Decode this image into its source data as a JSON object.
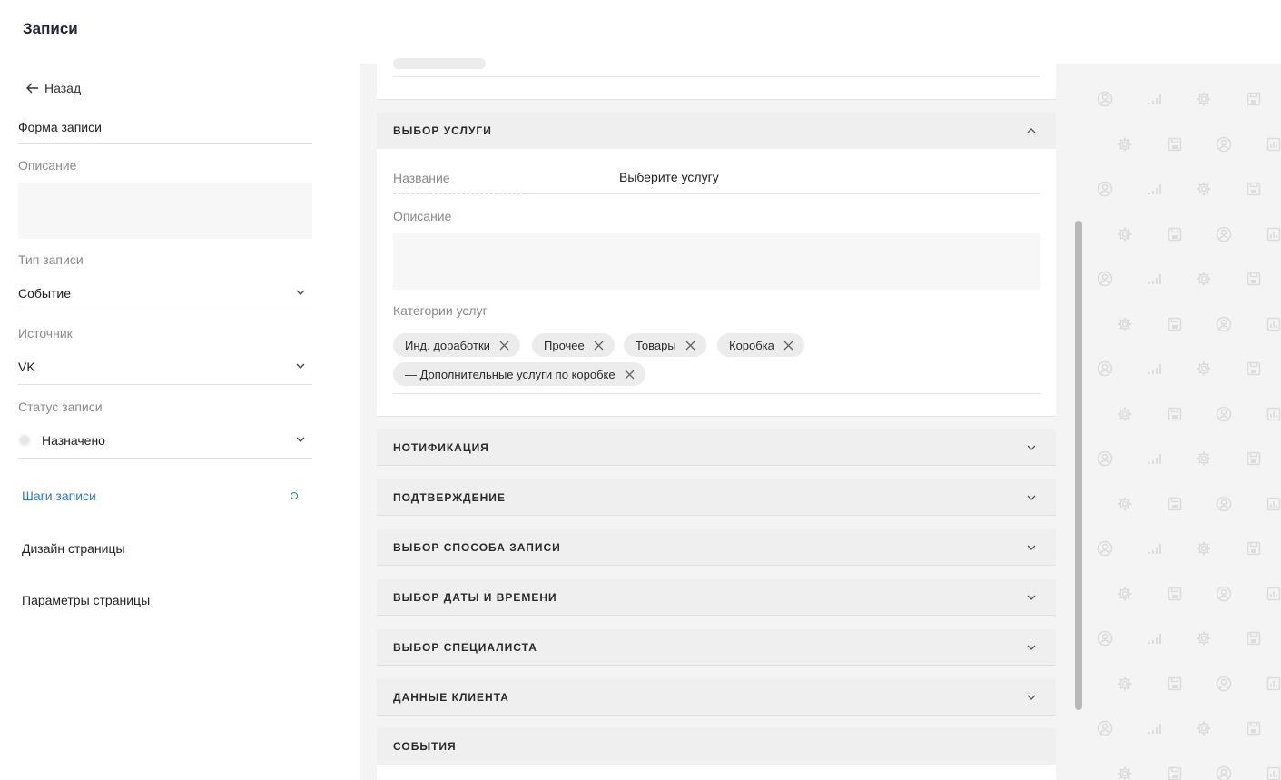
{
  "app": {
    "title": "Записи"
  },
  "left": {
    "back_label": "Назад",
    "form_value": "Форма записи",
    "description_label": "Описание",
    "type_label": "Тип записи",
    "type_value": "Событие",
    "source_label": "Источник",
    "source_value": "VK",
    "status_label": "Статус записи",
    "status_value": "Назначено",
    "nav": [
      {
        "label": "Шаги записи"
      },
      {
        "label": "Дизайн страницы"
      },
      {
        "label": "Параметры страницы"
      }
    ]
  },
  "service": {
    "header": "ВЫБОР УСЛУГИ",
    "name_label": "Название",
    "name_value": "Выберите услугу",
    "description_label": "Описание",
    "categories_label": "Категории услуг",
    "chips": [
      "Инд. доработки",
      "Прочее",
      "Товары",
      "Коробка",
      "— Дополнительные услуги по коробке"
    ]
  },
  "sections": [
    {
      "label": "НОТИФИКАЦИЯ"
    },
    {
      "label": "ПОДТВЕРЖДЕНИЕ"
    },
    {
      "label": "ВЫБОР СПОСОБА ЗАПИСИ"
    },
    {
      "label": "ВЫБОР ДАТЫ И ВРЕМЕНИ"
    },
    {
      "label": "ВЫБОР СПЕЦИАЛИСТА"
    },
    {
      "label": "ДАННЫЕ КЛИЕНТА"
    },
    {
      "label": "СОБЫТИЯ"
    }
  ],
  "colors": {
    "accent": "#2e7bbf",
    "section_bg": "#efefef",
    "pattern_icon": "#dcdcdc"
  },
  "icons": [
    "arrow-left-icon",
    "chevron-down-icon",
    "chevron-up-icon",
    "close-icon",
    "user-icon",
    "signal-icon",
    "gear-icon",
    "save-icon",
    "chart-icon"
  ]
}
